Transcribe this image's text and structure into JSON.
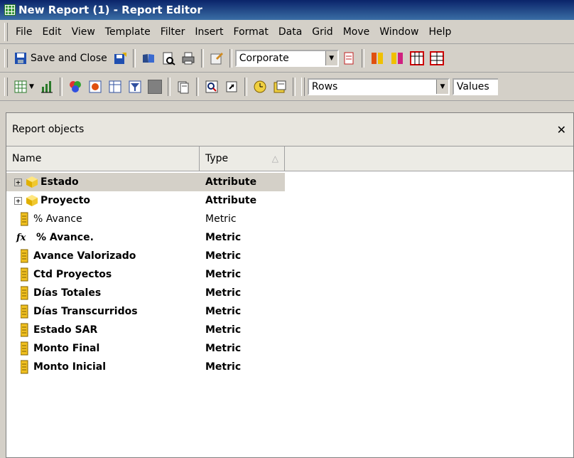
{
  "window": {
    "title": "New Report (1) - Report Editor"
  },
  "menu": [
    "File",
    "Edit",
    "View",
    "Template",
    "Filter",
    "Insert",
    "Format",
    "Data",
    "Grid",
    "Move",
    "Window",
    "Help"
  ],
  "toolbar1": {
    "save_label": "Save and Close",
    "template_combo": "Corporate"
  },
  "toolbar2": {
    "rows_combo": "Rows",
    "values_combo": "Values"
  },
  "panel": {
    "title": "Report objects",
    "columns": {
      "name": "Name",
      "type": "Type"
    },
    "items": [
      {
        "name": "Estado",
        "type": "Attribute"
      },
      {
        "name": "Proyecto",
        "type": "Attribute"
      },
      {
        "name": "% Avance",
        "type": "Metric"
      },
      {
        "name": "% Avance.",
        "type": "Metric"
      },
      {
        "name": "Avance Valorizado",
        "type": "Metric"
      },
      {
        "name": "Ctd Proyectos",
        "type": "Metric"
      },
      {
        "name": "Días Totales",
        "type": "Metric"
      },
      {
        "name": "Días Transcurridos",
        "type": "Metric"
      },
      {
        "name": "Estado SAR",
        "type": "Metric"
      },
      {
        "name": "Monto Final",
        "type": "Metric"
      },
      {
        "name": "Monto Inicial",
        "type": "Metric"
      }
    ]
  }
}
